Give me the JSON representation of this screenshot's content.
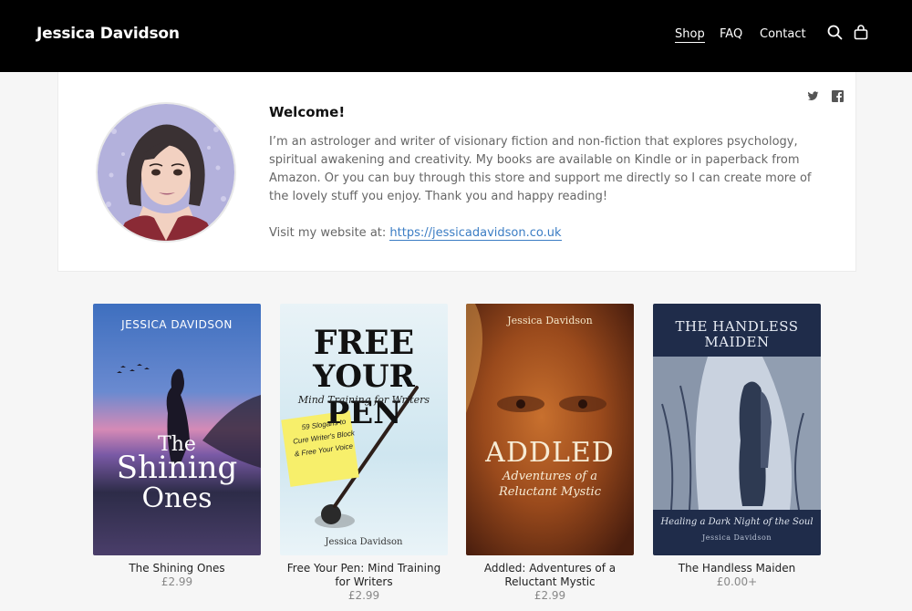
{
  "header": {
    "brand": "Jessica Davidson",
    "nav": [
      {
        "label": "Shop"
      },
      {
        "label": "FAQ"
      },
      {
        "label": "Contact"
      }
    ]
  },
  "welcome": {
    "title": "Welcome!",
    "intro": "I’m an astrologer and writer of visionary fiction and non-fiction that explores psychology, spiritual awakening and creativity. My books are available on Kindle or in paperback from Amazon. Or you can buy through this store and support me directly so I can create more of the lovely stuff you enjoy. Thank you and happy reading!",
    "visit_prefix": "Visit my website at: ",
    "website": "https://jessicadavidson.co.uk"
  },
  "products": [
    {
      "title": "The Shining Ones",
      "price": "£2.99",
      "cover": {
        "author": "JESSICA DAVIDSON",
        "title_line1": "The",
        "title_line2": "Shining",
        "title_line3": "Ones"
      }
    },
    {
      "title": "Free Your Pen: Mind Training for Writers",
      "price": "£2.99",
      "cover": {
        "title_line1": "FREE",
        "title_line2": "YOUR PEN",
        "subtitle": "Mind Training for Writers",
        "note_line1": "59 Slogans to",
        "note_line2": "Cure Writer's Block",
        "note_line3": "& Free Your Voice",
        "author": "Jessica Davidson"
      }
    },
    {
      "title": "Addled: Adventures of a Reluctant Mystic",
      "price": "£2.99",
      "cover": {
        "author": "Jessica Davidson",
        "title": "ADDLED",
        "subtitle_line1": "Adventures of a",
        "subtitle_line2": "Reluctant Mystic"
      }
    },
    {
      "title": "The Handless Maiden",
      "price": "£0.00+",
      "cover": {
        "title_line1": "THE HANDLESS",
        "title_line2": "MAIDEN",
        "subtitle": "Healing a Dark Night of the Soul",
        "author": "Jessica Davidson"
      }
    }
  ]
}
